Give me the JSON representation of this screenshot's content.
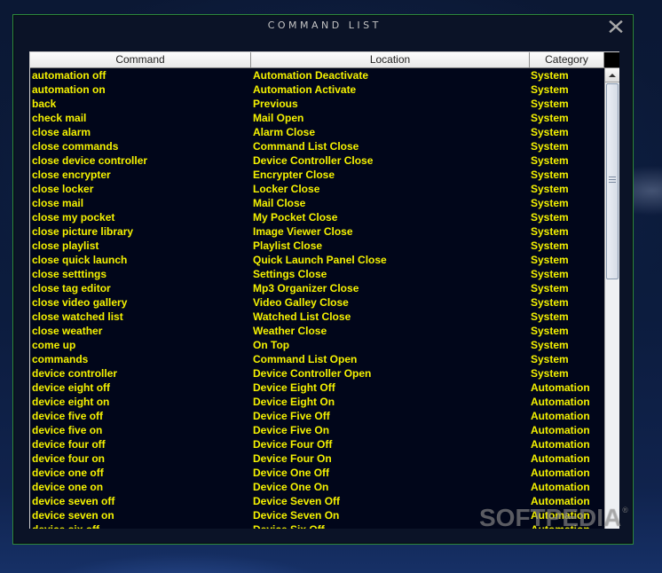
{
  "window": {
    "title": "COMMAND LIST"
  },
  "table": {
    "columns": [
      "Command",
      "Location",
      "Category"
    ],
    "rows": [
      {
        "command": "automation off",
        "location": "Automation Deactivate",
        "category": "System"
      },
      {
        "command": "automation on",
        "location": "Automation Activate",
        "category": "System"
      },
      {
        "command": "back",
        "location": "Previous",
        "category": "System"
      },
      {
        "command": "check mail",
        "location": "Mail Open",
        "category": "System"
      },
      {
        "command": "close alarm",
        "location": "Alarm Close",
        "category": "System"
      },
      {
        "command": "close commands",
        "location": "Command List Close",
        "category": "System"
      },
      {
        "command": "close device controller",
        "location": "Device Controller Close",
        "category": "System"
      },
      {
        "command": "close encrypter",
        "location": "Encrypter Close",
        "category": "System"
      },
      {
        "command": "close locker",
        "location": "Locker Close",
        "category": "System"
      },
      {
        "command": "close mail",
        "location": "Mail Close",
        "category": "System"
      },
      {
        "command": "close my pocket",
        "location": "My Pocket Close",
        "category": "System"
      },
      {
        "command": "close picture library",
        "location": "Image Viewer Close",
        "category": "System"
      },
      {
        "command": "close playlist",
        "location": "Playlist Close",
        "category": "System"
      },
      {
        "command": "close quick launch",
        "location": "Quick Launch Panel Close",
        "category": "System"
      },
      {
        "command": "close setttings",
        "location": "Settings Close",
        "category": "System"
      },
      {
        "command": "close tag editor",
        "location": "Mp3 Organizer Close",
        "category": "System"
      },
      {
        "command": "close video gallery",
        "location": "Video Galley Close",
        "category": "System"
      },
      {
        "command": "close watched list",
        "location": "Watched List Close",
        "category": "System"
      },
      {
        "command": "close weather",
        "location": "Weather Close",
        "category": "System"
      },
      {
        "command": "come up",
        "location": "On Top",
        "category": "System"
      },
      {
        "command": "commands",
        "location": "Command List Open",
        "category": "System"
      },
      {
        "command": "device controller",
        "location": "Device Controller Open",
        "category": "System"
      },
      {
        "command": "device eight off",
        "location": "Device Eight Off",
        "category": "Automation"
      },
      {
        "command": "device eight on",
        "location": "Device Eight On",
        "category": "Automation"
      },
      {
        "command": "device five off",
        "location": "Device Five Off",
        "category": "Automation"
      },
      {
        "command": "device five on",
        "location": "Device Five On",
        "category": "Automation"
      },
      {
        "command": "device four off",
        "location": "Device Four Off",
        "category": "Automation"
      },
      {
        "command": "device four on",
        "location": "Device Four On",
        "category": "Automation"
      },
      {
        "command": "device one off",
        "location": "Device One Off",
        "category": "Automation"
      },
      {
        "command": "device one on",
        "location": "Device One On",
        "category": "Automation"
      },
      {
        "command": "device seven off",
        "location": "Device Seven Off",
        "category": "Automation"
      },
      {
        "command": "device seven on",
        "location": "Device Seven On",
        "category": "Automation"
      },
      {
        "command": "device six off",
        "location": "Device Six Off",
        "category": "Automation"
      }
    ]
  },
  "watermark": {
    "text": "SOFTPEDIA",
    "mark": "®"
  },
  "icons": {
    "close": "close-icon",
    "scroll_up": "scroll-up-arrow-icon",
    "scroll_thumb": "grip-icon"
  },
  "colors": {
    "row_text": "#f5f200",
    "window_border": "#2e8a3d",
    "window_background": "#0b1327",
    "table_background": "#01061a"
  }
}
